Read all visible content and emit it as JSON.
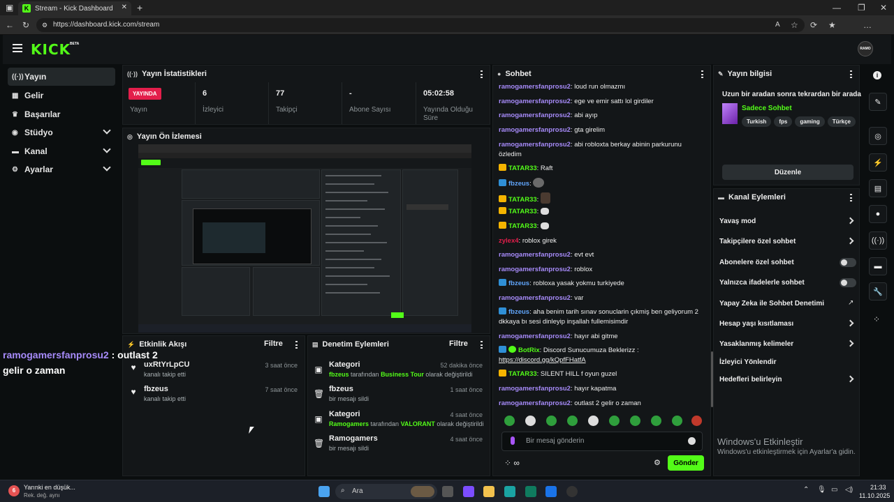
{
  "browser": {
    "tab_title": "Stream - Kick Dashboard",
    "url": "https://dashboard.kick.com/stream"
  },
  "app": {
    "logo": "KICK",
    "beta": "BETA",
    "avatar_text": "RAMO"
  },
  "leftnav": [
    {
      "label": "Yayın",
      "icon": "broadcast-icon"
    },
    {
      "label": "Gelir",
      "icon": "revenue-icon"
    },
    {
      "label": "Başarılar",
      "icon": "trophy-icon"
    },
    {
      "label": "Stüdyo",
      "icon": "studio-icon"
    },
    {
      "label": "Kanal",
      "icon": "channel-icon"
    },
    {
      "label": "Ayarlar",
      "icon": "settings-icon"
    }
  ],
  "stats": {
    "title": "Yayın İstatistikleri",
    "live_badge": "YAYINDA",
    "items": [
      {
        "value": "",
        "label": "Yayın"
      },
      {
        "value": "6",
        "label": "İzleyici"
      },
      {
        "value": "77",
        "label": "Takipçi"
      },
      {
        "value": "-",
        "label": "Abone Sayısı"
      },
      {
        "value": "05:02:58",
        "label": "Yayında Olduğu Süre"
      }
    ]
  },
  "preview": {
    "title": "Yayın Ön İzlemesi"
  },
  "activity": {
    "title": "Etkinlik Akışı",
    "filter": "Filtre",
    "rows": [
      {
        "name": "uxRtYrLpCU",
        "sub": "kanalı takip etti",
        "time": "3 saat önce"
      },
      {
        "name": "fbzeus",
        "sub": "kanalı takip etti",
        "time": "7 saat önce"
      }
    ]
  },
  "moderation": {
    "title": "Denetim Eylemleri",
    "filter": "Filtre",
    "rows": [
      {
        "title": "Kategori",
        "user": "fbzeus",
        "mid": " tarafından ",
        "value": "Business Tour",
        "end": " olarak değiştirildi",
        "time": "52 dakika önce"
      },
      {
        "title": "fbzeus",
        "sub": "bir mesajı sildi",
        "time": "1 saat önce"
      },
      {
        "title": "Kategori",
        "user": "Ramogamers",
        "mid": " tarafından ",
        "value": "VALORANT",
        "end": " olarak değiştirildi",
        "time": "4 saat önce"
      },
      {
        "title": "Ramogamers",
        "sub": "bir mesajı sildi",
        "time": "4 saat önce"
      }
    ]
  },
  "chat": {
    "title": "Sohbet",
    "messages": [
      {
        "user": "ramogamersfanprosu2",
        "text": "loud run olmazmı"
      },
      {
        "user": "ramogamersfanprosu2",
        "text": "ege ve emir sattı lol girdiler"
      },
      {
        "user": "ramogamersfanprosu2",
        "text": "abi ayıp"
      },
      {
        "user": "ramogamersfanprosu2",
        "text": "gta girelim"
      },
      {
        "user": "ramogamersfanprosu2",
        "text": "abi robloxta berkay abinin parkurunu özledim"
      },
      {
        "user": "TATAR33",
        "text": "Raft"
      },
      {
        "user": "fbzeus",
        "text": ""
      },
      {
        "user": "TATAR33",
        "text": ""
      },
      {
        "user": "TATAR33",
        "text": ""
      },
      {
        "user": "TATAR33",
        "text": ""
      },
      {
        "user": "zylex4",
        "text": "roblox girek"
      },
      {
        "user": "ramogamersfanprosu2",
        "text": "evt evt"
      },
      {
        "user": "ramogamersfanprosu2",
        "text": "roblox"
      },
      {
        "user": "fbzeus",
        "text": "robloxa yasak yokmu turkiyede"
      },
      {
        "user": "ramogamersfanprosu2",
        "text": "var"
      },
      {
        "user": "fbzeus",
        "text": "aha benim tarih sınav sonuclarin çıkmiş ben geliyorum 2 dkkaya bı sesi dinleyip inşallah fullemisimdir"
      },
      {
        "user": "ramogamersfanprosu2",
        "text": "hayır abi gitme"
      },
      {
        "user": "BotRix",
        "text": "Discord Sunucumuza Beklerizz :",
        "link": "https://discord.gg/kQpfFHatfA"
      },
      {
        "user": "TATAR33",
        "text": "SILENT HILL f oyun guzel"
      },
      {
        "user": "ramogamersfanprosu2",
        "text": "hayır kapatma"
      },
      {
        "user": "ramogamersfanprosu2",
        "text": "outlast 2 gelir o zaman"
      }
    ],
    "placeholder": "Bir mesaj gönderin",
    "send": "Gönder"
  },
  "info": {
    "title": "Yayın bilgisi",
    "stream_title": "Uzun bir aradan sonra tekrardan bir arada",
    "category": "Sadece Sohbet",
    "tags": [
      "Turkish",
      "fps",
      "gaming",
      "Türkçe"
    ],
    "edit": "Düzenle"
  },
  "channel_actions": {
    "title": "Kanal Eylemleri",
    "items": [
      {
        "label": "Yavaş mod",
        "control": "arrow"
      },
      {
        "label": "Takipçilere özel sohbet",
        "control": "arrow"
      },
      {
        "label": "Abonelere özel sohbet",
        "control": "toggle"
      },
      {
        "label": "Yalnızca ifadelerle sohbet",
        "control": "toggle"
      },
      {
        "label": "Yapay Zeka ile Sohbet Denetimi",
        "control": "external"
      },
      {
        "label": "Hesap yaşı kısıtlaması",
        "control": "arrow"
      },
      {
        "label": "Yasaklanmış kelimeler",
        "control": "arrow"
      },
      {
        "label": "İzleyici Yönlendir",
        "control": "none"
      },
      {
        "label": "Hedefleri belirleyin",
        "control": "arrow"
      }
    ]
  },
  "overlay": {
    "user": "ramogamersfanprosu2",
    "text": " : outlast 2 gelir o zaman"
  },
  "watermark": {
    "line1": "Windows'u Etkinleştir",
    "line2": "Windows'u etkinleştirmek için Ayarlar'a gidin."
  },
  "taskbar": {
    "weather_badge": "6",
    "weather_title": "Yarınki en düşük...",
    "weather_sub": "Rek. değ. aynı",
    "search": "Ara",
    "time": "21:33",
    "date": "11.10.2025"
  }
}
